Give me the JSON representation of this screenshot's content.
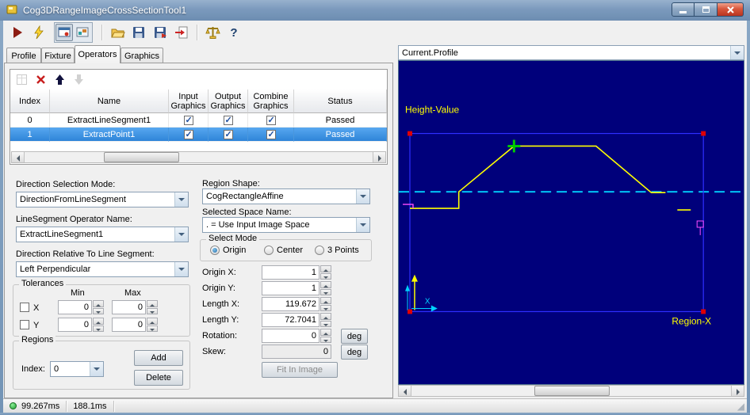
{
  "window": {
    "title": "Cog3DRangeImageCrossSectionTool1"
  },
  "toolbar": {
    "buttons": [
      "run",
      "electric-run",
      "graphics-display",
      "image-record",
      "open-file",
      "save",
      "save-image",
      "import-image",
      "benchmark",
      "help"
    ],
    "help_glyph": "?"
  },
  "tabs": {
    "items": [
      {
        "label": "Profile"
      },
      {
        "label": "Fixture"
      },
      {
        "label": "Operators"
      },
      {
        "label": "Graphics"
      }
    ],
    "active": "Operators"
  },
  "operators": {
    "table": {
      "columns": [
        "Index",
        "Name",
        "Input Graphics",
        "Output Graphics",
        "Combine Graphics",
        "Status"
      ],
      "rows": [
        {
          "index": "0",
          "name": "ExtractLineSegment1",
          "input_graphics": true,
          "output_graphics": true,
          "combine_graphics": true,
          "status": "Passed",
          "selected": false
        },
        {
          "index": "1",
          "name": "ExtractPoint1",
          "input_graphics": true,
          "output_graphics": true,
          "combine_graphics": true,
          "status": "Passed",
          "selected": true
        }
      ]
    },
    "direction_selection_mode": {
      "label": "Direction Selection Mode:",
      "value": "DirectionFromLineSegment"
    },
    "linesegment_operator_name": {
      "label": "LineSegment Operator Name:",
      "value": "ExtractLineSegment1"
    },
    "direction_relative": {
      "label": "Direction Relative To Line Segment:",
      "value": "Left Perpendicular"
    },
    "tolerances": {
      "title": "Tolerances",
      "min_header": "Min",
      "max_header": "Max",
      "rows": [
        {
          "label": "X",
          "min": "0",
          "max": "0",
          "checked": false
        },
        {
          "label": "Y",
          "min": "0",
          "max": "0",
          "checked": false
        }
      ]
    },
    "regions": {
      "title": "Regions",
      "index_label": "Index:",
      "index_value": "0",
      "add_label": "Add",
      "delete_label": "Delete"
    },
    "region_shape": {
      "label": "Region Shape:",
      "value": "CogRectangleAffine"
    },
    "selected_space": {
      "label": "Selected Space Name:",
      "value": ". = Use Input Image Space"
    },
    "select_mode": {
      "title": "Select Mode",
      "options": [
        {
          "label": "Origin",
          "selected": true
        },
        {
          "label": "Center",
          "selected": false
        },
        {
          "label": "3 Points",
          "selected": false
        }
      ]
    },
    "region_fields": [
      {
        "label": "Origin X:",
        "value": "1"
      },
      {
        "label": "Origin Y:",
        "value": "1"
      },
      {
        "label": "Length X:",
        "value": "119.672"
      },
      {
        "label": "Length Y:",
        "value": "72.7041"
      },
      {
        "label": "Rotation:",
        "value": "0",
        "unit": "deg"
      },
      {
        "label": "Skew:",
        "value": "0",
        "unit": "deg"
      }
    ],
    "fit_button": "Fit In Image"
  },
  "display": {
    "selector": "Current.Profile",
    "y_axis_label": "Height-Value",
    "x_axis_label": "Region-X",
    "x_marker": "X"
  },
  "status_bar": {
    "time1": "99.267ms",
    "time2": "188.1ms"
  },
  "colors": {
    "selection": "#2f86d8",
    "canvas": "#00007b",
    "profile": "#ffff00",
    "crosshair": "#00d2ff",
    "close_button": "#b93420"
  }
}
